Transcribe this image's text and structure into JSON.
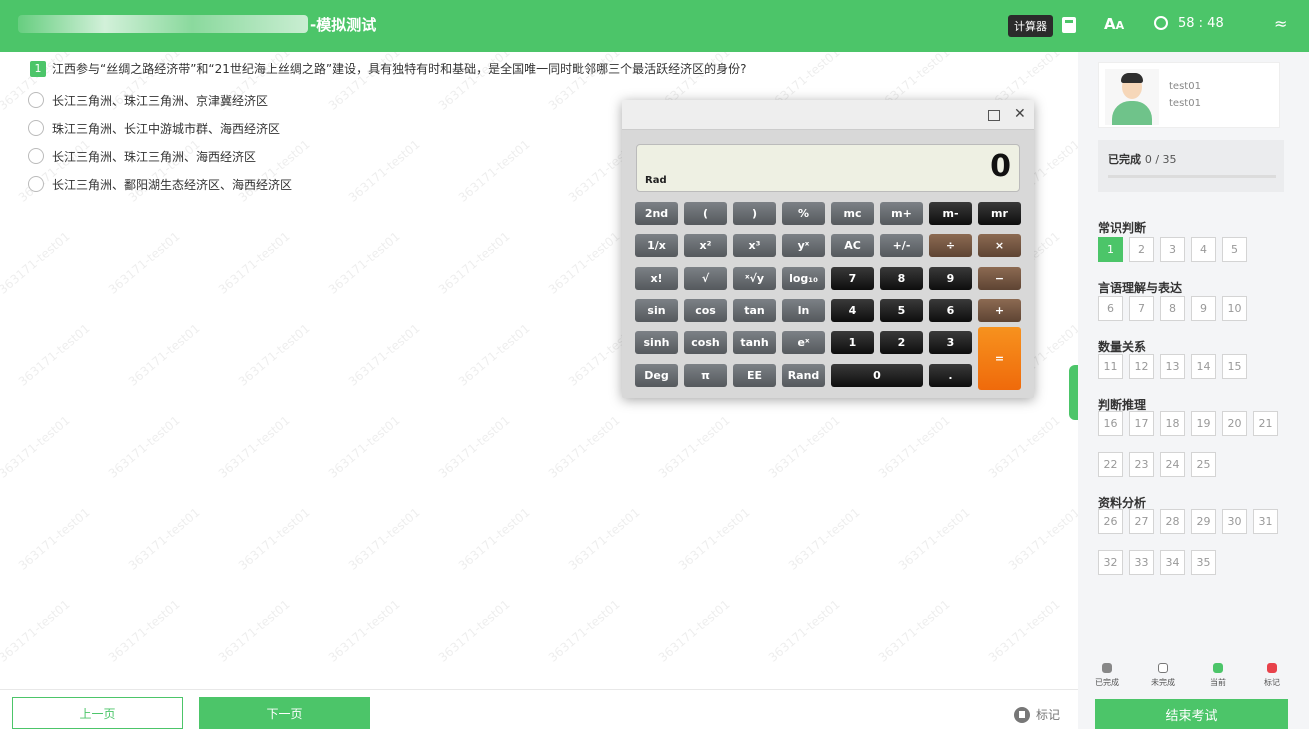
{
  "header": {
    "title_suffix": "-模拟测试",
    "calculator_tooltip": "计算器",
    "font_label": "A",
    "timer": "58 : 48",
    "icons": [
      "calculator-icon",
      "font-size-icon",
      "timer-icon",
      "wifi-icon"
    ]
  },
  "question": {
    "number": "1",
    "text": "江西参与“丝绸之路经济带”和“21世纪海上丝绸之路”建设，具有独特有时和基础，是全国唯一同时毗邻哪三个最活跃经济区的身份?",
    "options": [
      "长江三角洲、珠江三角洲、京津冀经济区",
      "珠江三角洲、长江中游城市群、海西经济区",
      "长江三角洲、珠江三角洲、海西经济区",
      "长江三角洲、鄱阳湖生态经济区、海西经济区"
    ]
  },
  "watermark": "363171-test01",
  "calculator": {
    "mode": "Rad",
    "display": "0",
    "rows": [
      [
        "2nd",
        "(",
        ")",
        "%",
        "mc",
        "m+",
        "m-",
        "mr"
      ],
      [
        "1/x",
        "x²",
        "x³",
        "yˣ",
        "AC",
        "+/-",
        "÷",
        "×"
      ],
      [
        "x!",
        "√",
        "ˣ√y",
        "log₁₀",
        "7",
        "8",
        "9",
        "−"
      ],
      [
        "sin",
        "cos",
        "tan",
        "ln",
        "4",
        "5",
        "6",
        "+"
      ],
      [
        "sinh",
        "cosh",
        "tanh",
        "eˣ",
        "1",
        "2",
        "3",
        "="
      ],
      [
        "Deg",
        "π",
        "EE",
        "Rand",
        "0",
        "."
      ]
    ]
  },
  "user": {
    "name": "test01",
    "id": "test01"
  },
  "progress": {
    "label": "已完成",
    "completed": 0,
    "total": 35,
    "text": "0 / 35"
  },
  "sections": [
    {
      "name": "常识判断",
      "items": [
        "1",
        "2",
        "3",
        "4",
        "5"
      ]
    },
    {
      "name": "言语理解与表达",
      "items": [
        "6",
        "7",
        "8",
        "9",
        "10"
      ]
    },
    {
      "name": "数量关系",
      "items": [
        "11",
        "12",
        "13",
        "14",
        "15"
      ]
    },
    {
      "name": "判断推理",
      "items": [
        "16",
        "17",
        "18",
        "19",
        "20",
        "21",
        "22",
        "23",
        "24",
        "25"
      ]
    },
    {
      "name": "资料分析",
      "items": [
        "26",
        "27",
        "28",
        "29",
        "30",
        "31",
        "32",
        "33",
        "34",
        "35"
      ]
    }
  ],
  "current_question": "1",
  "legend": [
    {
      "label": "已完成",
      "color": "#888888"
    },
    {
      "label": "未完成",
      "color": "#ffffff"
    },
    {
      "label": "当前",
      "color": "#4cc569"
    },
    {
      "label": "标记",
      "color": "#e8424b"
    }
  ],
  "footer": {
    "prev": "上一页",
    "next": "下一页",
    "mark": "标记",
    "end": "结束考试"
  },
  "colors": {
    "accent": "#4cc569",
    "calc_orange": "#f7921e"
  }
}
